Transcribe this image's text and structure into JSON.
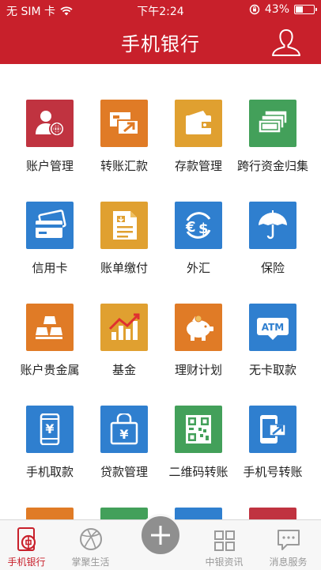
{
  "status_bar": {
    "carrier": "无 SIM 卡",
    "time": "下午2:24",
    "battery_percent": "43%",
    "battery_level": 0.43
  },
  "header": {
    "title": "手机银行"
  },
  "grid": {
    "items": [
      {
        "label": "账户管理",
        "icon": "account-icon",
        "color": "#c03340"
      },
      {
        "label": "转账汇款",
        "icon": "transfer-icon",
        "color": "#e07b26"
      },
      {
        "label": "存款管理",
        "icon": "wallet-icon",
        "color": "#e0a030"
      },
      {
        "label": "跨行资金归集",
        "icon": "cash-stack-icon",
        "color": "#43a05a"
      },
      {
        "label": "信用卡",
        "icon": "credit-card-icon",
        "color": "#2f7fcf"
      },
      {
        "label": "账单缴付",
        "icon": "bill-icon",
        "color": "#e0a030"
      },
      {
        "label": "外汇",
        "icon": "currency-exchange-icon",
        "color": "#2f7fcf"
      },
      {
        "label": "保险",
        "icon": "umbrella-icon",
        "color": "#2f7fcf"
      },
      {
        "label": "账户贵金属",
        "icon": "gold-bars-icon",
        "color": "#e07b26"
      },
      {
        "label": "基金",
        "icon": "fund-chart-icon",
        "color": "#e0a030"
      },
      {
        "label": "理财计划",
        "icon": "piggy-bank-icon",
        "color": "#e07b26"
      },
      {
        "label": "无卡取款",
        "icon": "atm-icon",
        "color": "#2f7fcf"
      },
      {
        "label": "手机取款",
        "icon": "phone-yuan-icon",
        "color": "#2f7fcf"
      },
      {
        "label": "贷款管理",
        "icon": "loan-bag-icon",
        "color": "#2f7fcf"
      },
      {
        "label": "二维码转账",
        "icon": "qr-code-icon",
        "color": "#43a05a"
      },
      {
        "label": "手机号转账",
        "icon": "phone-transfer-icon",
        "color": "#2f7fcf"
      }
    ],
    "partial_row_colors": [
      "#e07b26",
      "#43a05a",
      "#2f7fcf",
      "#c03340"
    ]
  },
  "tabbar": {
    "tabs": [
      {
        "label": "手机银行",
        "icon": "bank-logo-icon",
        "active": true
      },
      {
        "label": "掌聚生活",
        "icon": "ball-icon",
        "active": false
      },
      {
        "label": "",
        "icon": "plus-icon",
        "active": false
      },
      {
        "label": "中银资讯",
        "icon": "grid-icon",
        "active": false
      },
      {
        "label": "消息服务",
        "icon": "message-icon",
        "active": false
      }
    ]
  },
  "colors": {
    "brand_red": "#c8202b",
    "tab_inactive": "#999999"
  }
}
